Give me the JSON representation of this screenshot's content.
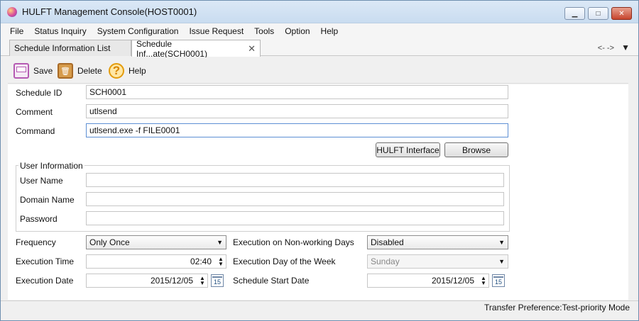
{
  "window": {
    "title": "HULFT Management Console(HOST0001)"
  },
  "window_controls": {
    "minimize": "▁",
    "maximize": "□",
    "close": "✕"
  },
  "menu": {
    "items": [
      "File",
      "Status Inquiry",
      "System Configuration",
      "Issue Request",
      "Tools",
      "Option",
      "Help"
    ]
  },
  "tabs": [
    {
      "label": "Schedule Information List"
    },
    {
      "label": "Schedule Inf...ate(SCH0001)",
      "close": "✕"
    }
  ],
  "nav": {
    "arrows": "<-  ->",
    "view_menu": "▼"
  },
  "toolbar": {
    "save": "Save",
    "delete": "Delete",
    "help": "Help",
    "delete_icon": "🗑",
    "help_icon": "?"
  },
  "form": {
    "schedule_id_label": "Schedule ID",
    "schedule_id_value": "SCH0001",
    "comment_label": "Comment",
    "comment_value": "utlsend",
    "command_label": "Command",
    "command_value": "utlsend.exe -f FILE0001",
    "hulft_interface": "HULFT Interface",
    "browse": "Browse",
    "user_information": "User Information",
    "user_name_label": "User Name",
    "domain_name_label": "Domain Name",
    "password_label": "Password",
    "frequency_label": "Frequency",
    "frequency_value": "Only Once",
    "nonworking_label": "Execution on Non-working Days",
    "nonworking_value": "Disabled",
    "execution_time_label": "Execution Time",
    "execution_time_value": "02:40",
    "execution_day_label": "Execution Day of the Week",
    "execution_day_value": "Sunday",
    "execution_date_label": "Execution Date",
    "execution_date_value": "2015/12/05",
    "start_date_label": "Schedule Start Date",
    "start_date_value": "2015/12/05",
    "calendar_label": "15"
  },
  "status": {
    "text": "Transfer Preference:Test-priority Mode"
  }
}
